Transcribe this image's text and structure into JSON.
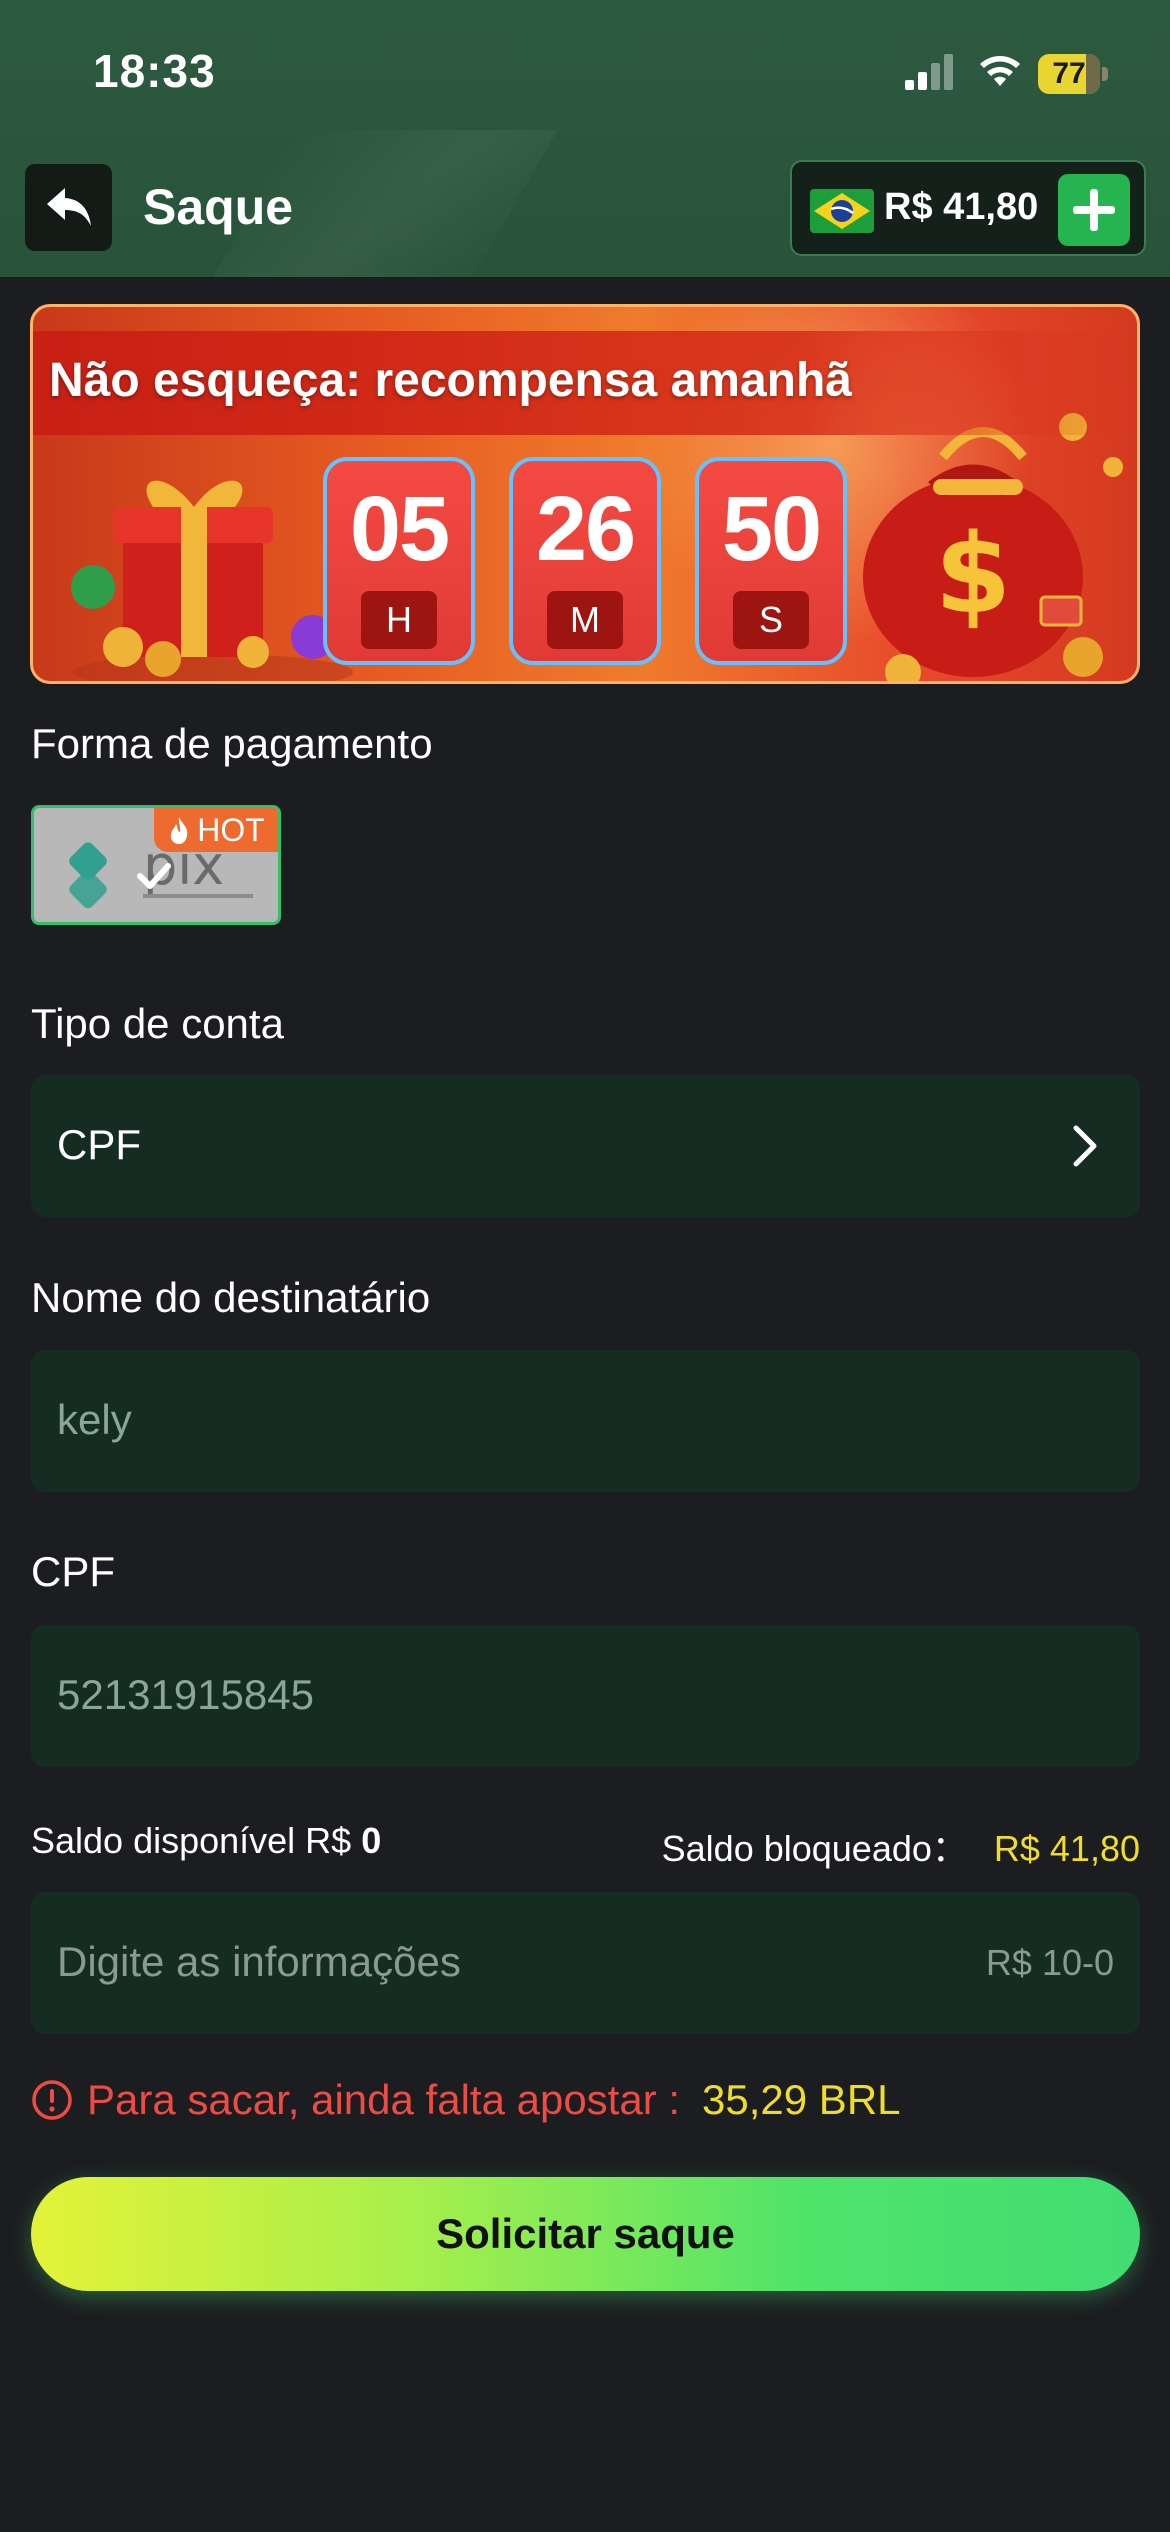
{
  "status_bar": {
    "time": "18:33",
    "battery": "77",
    "icons": [
      "signal-icon",
      "wifi-icon",
      "battery-icon"
    ]
  },
  "header": {
    "title": "Saque",
    "balance": "R$ 41,80",
    "back_icon": "back-arrow-icon",
    "flag_icon": "brazil-flag-icon",
    "add_icon": "plus-icon"
  },
  "banner": {
    "title": "Não esqueça: recompensa amanhã",
    "timer": [
      {
        "value": "05",
        "unit": "H"
      },
      {
        "value": "26",
        "unit": "M"
      },
      {
        "value": "50",
        "unit": "S"
      }
    ]
  },
  "payment": {
    "label": "Forma de pagamento",
    "method": "pix",
    "badge": "HOT"
  },
  "account_type": {
    "label": "Tipo de conta",
    "value": "CPF"
  },
  "recipient": {
    "label": "Nome do destinatário",
    "value": "kely"
  },
  "cpf": {
    "label": "CPF",
    "value": "52131915845"
  },
  "saldo": {
    "available_label": "Saldo disponível R$",
    "available_value": "0",
    "blocked_label": "Saldo bloqueado：",
    "blocked_value": "R$ 41,80"
  },
  "amount": {
    "placeholder": "Digite as informações",
    "range": "R$ 10-0"
  },
  "warning": {
    "text": "Para sacar, ainda falta apostar :",
    "amount": "35,29 BRL"
  },
  "submit_label": "Solicitar saque",
  "colors": {
    "accent_green": "#41dd72",
    "accent_yellow": "#f1dc2a",
    "warning_red": "#ee4b45",
    "field_bg": "#152c22",
    "page_bg": "#1c1d20"
  }
}
